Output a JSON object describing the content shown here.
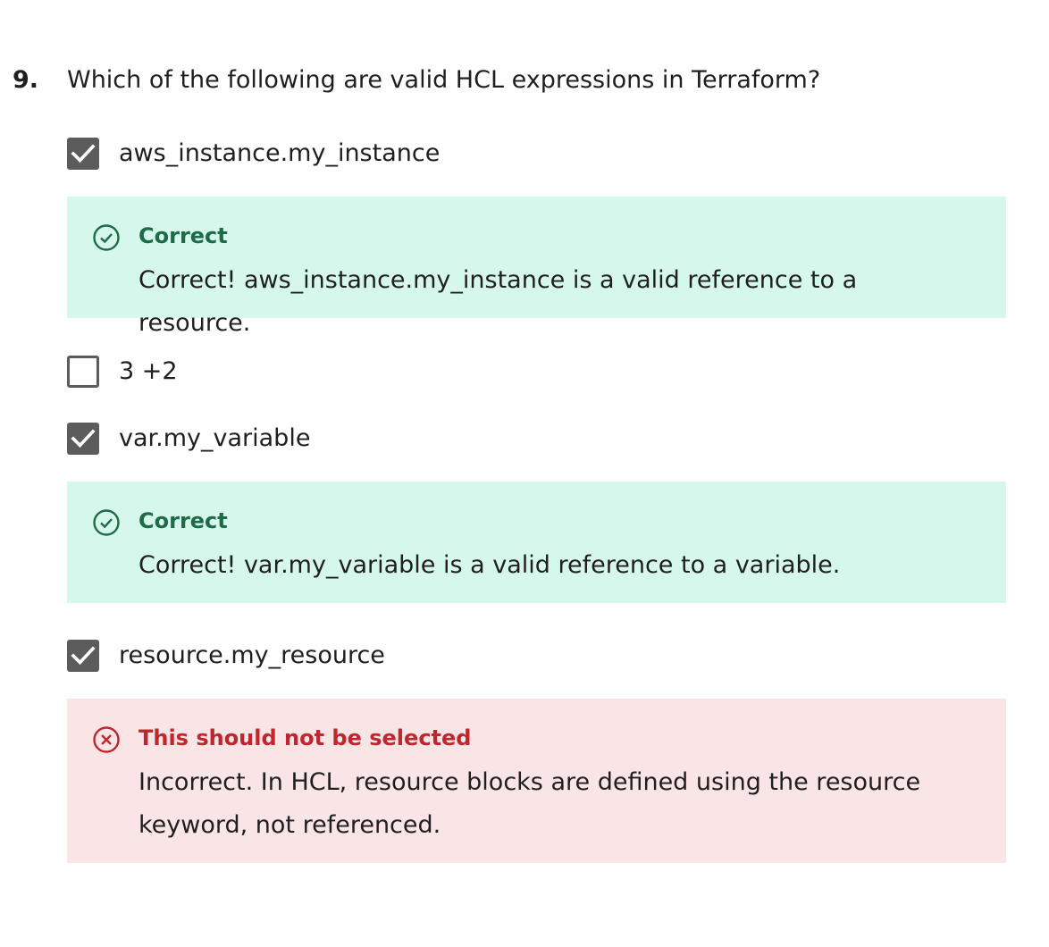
{
  "question": {
    "number": "9.",
    "text": "Which of the following are valid HCL expressions in Terraform?"
  },
  "options": [
    {
      "label": "aws_instance.my_instance",
      "checked": true,
      "feedback": {
        "status": "correct",
        "title": "Correct",
        "text": "Correct! aws_instance.my_instance is a valid reference to a resource."
      }
    },
    {
      "label": "3 +2",
      "checked": false
    },
    {
      "label": "var.my_variable",
      "checked": true,
      "feedback": {
        "status": "correct",
        "title": "Correct",
        "text": "Correct! var.my_variable is a valid reference to a variable."
      }
    },
    {
      "label": "resource.my_resource",
      "checked": true,
      "feedback": {
        "status": "incorrect",
        "title": "This should not be selected",
        "text": "Incorrect. In HCL, resource blocks are defined using the resource keyword, not referenced."
      }
    }
  ],
  "icons": {
    "checkmark": "checkmark-icon",
    "correct": "check-circle-icon",
    "incorrect": "x-circle-icon"
  },
  "colors": {
    "correct_bg": "#d6f7ec",
    "correct_text": "#1e6b47",
    "incorrect_bg": "#f9e4e6",
    "incorrect_text": "#c0262d",
    "checkbox": "#5c5c5c"
  }
}
